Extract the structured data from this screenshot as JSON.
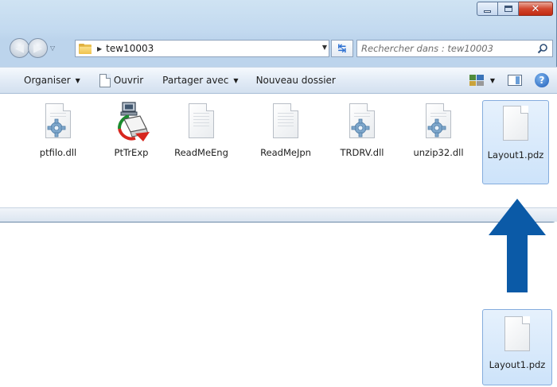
{
  "address_bar": {
    "breadcrumb": "tew10003"
  },
  "search": {
    "placeholder": "Rechercher dans : tew10003"
  },
  "command_bar": {
    "organize": "Organiser",
    "open": "Ouvrir",
    "share": "Partager avec",
    "new_folder": "Nouveau dossier"
  },
  "files": [
    {
      "name": "ptfilo.dll",
      "icon": "dll-gear-icon"
    },
    {
      "name": "PtTrExp",
      "icon": "transfer-app-icon"
    },
    {
      "name": "ReadMeEng",
      "icon": "document-icon"
    },
    {
      "name": "ReadMeJpn",
      "icon": "document-icon"
    },
    {
      "name": "TRDRV.dll",
      "icon": "dll-gear-icon"
    },
    {
      "name": "unzip32.dll",
      "icon": "dll-gear-icon"
    },
    {
      "name": "Layout1.pdz",
      "icon": "document-icon",
      "selected": true
    }
  ],
  "dragged_file": {
    "name": "Layout1.pdz",
    "icon": "document-icon"
  },
  "colors": {
    "arrow": "#0b5aa7",
    "selection": "#cde3fa",
    "close_button": "#c9371c"
  }
}
